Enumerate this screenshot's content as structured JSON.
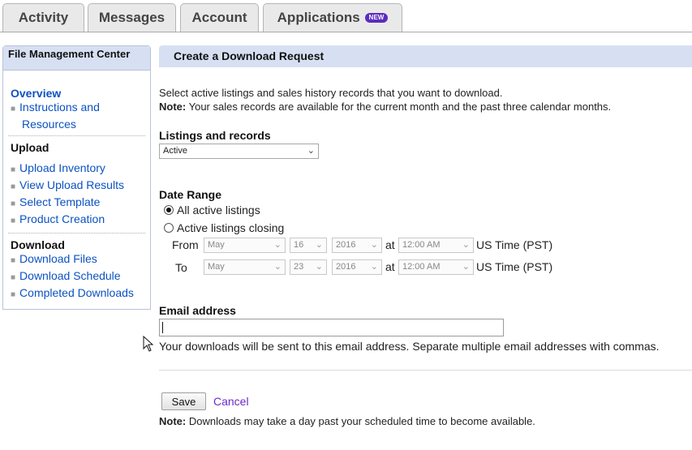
{
  "tabs": [
    {
      "label": "Activity"
    },
    {
      "label": "Messages"
    },
    {
      "label": "Account"
    },
    {
      "label": "Applications",
      "badge": "NEW"
    }
  ],
  "sidebar": {
    "title": "File Management Center",
    "overview": "Overview",
    "overview_links": [
      "Instructions and",
      "Resources"
    ],
    "upload_title": "Upload",
    "upload_links": [
      "Upload Inventory",
      "View Upload Results",
      "Select Template",
      "Product Creation"
    ],
    "download_title": "Download",
    "download_links": [
      "Download Files",
      "Download Schedule",
      "Completed Downloads"
    ]
  },
  "main": {
    "header": "Create a Download Request",
    "intro": "Select active listings and sales history records that you want to download.",
    "note_label": "Note:",
    "note_text": "Your sales records are available for the current month and the past three calendar months.",
    "listings_label": "Listings and records",
    "listings_value": "Active",
    "date_range_label": "Date Range",
    "radio_all": "All active listings",
    "radio_closing": "Active listings closing",
    "from_label": "From",
    "to_label": "To",
    "from": {
      "month": "May",
      "day": "16",
      "year": "2016",
      "time": "12:00 AM"
    },
    "to": {
      "month": "May",
      "day": "23",
      "year": "2016",
      "time": "12:00 AM"
    },
    "at_label": "at",
    "tz_label": "US Time (PST)",
    "email_label": "Email address",
    "email_value": "",
    "email_help": "Your downloads will be sent to this email address. Separate multiple email addresses with commas.",
    "save_label": "Save",
    "cancel_label": "Cancel",
    "bottom_note_label": "Note:",
    "bottom_note_text": "Downloads may take a day past your scheduled time to become available."
  },
  "colors": {
    "accent_header": "#d7e0f3",
    "link": "#0b52c2",
    "badge": "#5b2cbf",
    "cancel": "#6a2bc8"
  }
}
